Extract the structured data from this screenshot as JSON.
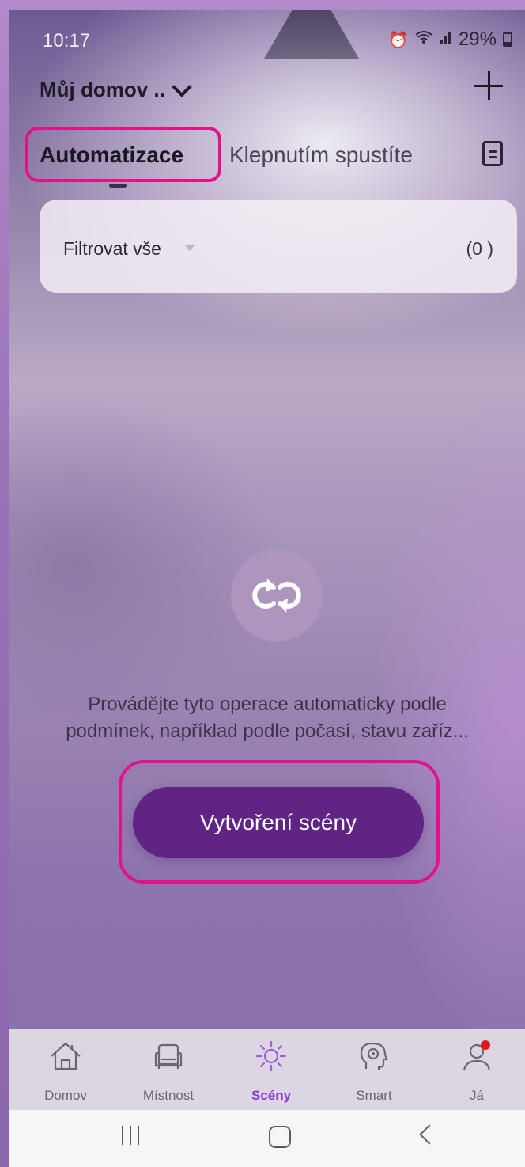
{
  "status": {
    "time": "10:17",
    "battery": "29%",
    "icons": [
      "alarm-icon",
      "wifi-icon",
      "signal-icon",
      "battery-icon"
    ]
  },
  "header": {
    "home_name": "Můj domov ..",
    "add_icon": "plus-icon"
  },
  "tabs": [
    {
      "label": "Automatizace",
      "active": true
    },
    {
      "label": "Klepnutím spustíte",
      "active": false
    }
  ],
  "filter": {
    "label": "Filtrovat vše",
    "count": "(0 )"
  },
  "empty_state": {
    "icon": "automation-loop-icon",
    "line1": "Provádějte tyto operace automaticky podle",
    "line2": "podmínek, například podle počasí, stavu zaříz..."
  },
  "create_button": "Vytvoření scény",
  "highlight_color": "#e0148a",
  "bottom_nav": [
    {
      "label": "Domov",
      "icon": "house-icon",
      "active": false
    },
    {
      "label": "Místnost",
      "icon": "armchair-icon",
      "active": false
    },
    {
      "label": "Scény",
      "icon": "sun-icon",
      "active": true
    },
    {
      "label": "Smart",
      "icon": "brain-gear-icon",
      "active": false
    },
    {
      "label": "Já",
      "icon": "user-icon",
      "active": false
    }
  ],
  "colors": {
    "accent_button": "#5f2484",
    "active_tab": "#8b3bd6",
    "notification_dot": "#e01818"
  }
}
